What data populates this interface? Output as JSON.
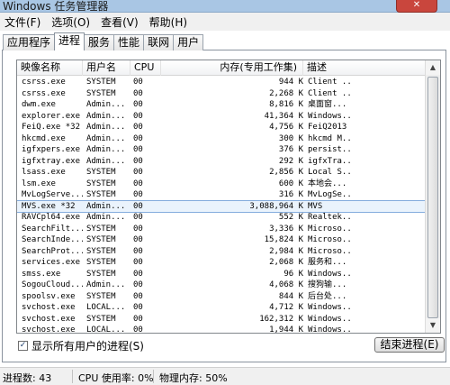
{
  "window": {
    "title": "Windows 任务管理器",
    "close_glyph": "✕"
  },
  "menu": [
    "文件(F)",
    "选项(O)",
    "查看(V)",
    "帮助(H)"
  ],
  "tabs": [
    "应用程序",
    "进程",
    "服务",
    "性能",
    "联网",
    "用户"
  ],
  "active_tab": "进程",
  "columns": {
    "name": "映像名称",
    "user": "用户名",
    "cpu": "CPU",
    "mem": "内存(专用工作集)",
    "desc": "描述"
  },
  "processes": [
    {
      "name": "csrss.exe",
      "user": "SYSTEM",
      "cpu": "00",
      "mem": "944 K",
      "desc": "Client ..."
    },
    {
      "name": "csrss.exe",
      "user": "SYSTEM",
      "cpu": "00",
      "mem": "2,268 K",
      "desc": "Client ..."
    },
    {
      "name": "dwm.exe",
      "user": "Admin...",
      "cpu": "00",
      "mem": "8,816 K",
      "desc": "桌面窗..."
    },
    {
      "name": "explorer.exe",
      "user": "Admin...",
      "cpu": "00",
      "mem": "41,364 K",
      "desc": "Windows..."
    },
    {
      "name": "FeiQ.exe *32",
      "user": "Admin...",
      "cpu": "00",
      "mem": "4,756 K",
      "desc": "FeiQ2013"
    },
    {
      "name": "hkcmd.exe",
      "user": "Admin...",
      "cpu": "00",
      "mem": "300 K",
      "desc": "hkcmd M..."
    },
    {
      "name": "igfxpers.exe",
      "user": "Admin...",
      "cpu": "00",
      "mem": "376 K",
      "desc": "persist..."
    },
    {
      "name": "igfxtray.exe",
      "user": "Admin...",
      "cpu": "00",
      "mem": "292 K",
      "desc": "igfxTra..."
    },
    {
      "name": "lsass.exe",
      "user": "SYSTEM",
      "cpu": "00",
      "mem": "2,856 K",
      "desc": "Local S..."
    },
    {
      "name": "lsm.exe",
      "user": "SYSTEM",
      "cpu": "00",
      "mem": "600 K",
      "desc": "本地会..."
    },
    {
      "name": "MvLogServe...",
      "user": "SYSTEM",
      "cpu": "00",
      "mem": "316 K",
      "desc": "MvLogSe..."
    },
    {
      "name": "MVS.exe *32",
      "user": "Admin...",
      "cpu": "00",
      "mem": "3,088,964 K",
      "desc": "MVS",
      "selected": true
    },
    {
      "name": "RAVCpl64.exe",
      "user": "Admin...",
      "cpu": "00",
      "mem": "552 K",
      "desc": "Realtek..."
    },
    {
      "name": "SearchFilt...",
      "user": "SYSTEM",
      "cpu": "00",
      "mem": "3,336 K",
      "desc": "Microso..."
    },
    {
      "name": "SearchInde...",
      "user": "SYSTEM",
      "cpu": "00",
      "mem": "15,824 K",
      "desc": "Microso..."
    },
    {
      "name": "SearchProt...",
      "user": "SYSTEM",
      "cpu": "00",
      "mem": "2,984 K",
      "desc": "Microso..."
    },
    {
      "name": "services.exe",
      "user": "SYSTEM",
      "cpu": "00",
      "mem": "2,068 K",
      "desc": "服务和..."
    },
    {
      "name": "smss.exe",
      "user": "SYSTEM",
      "cpu": "00",
      "mem": "96 K",
      "desc": "Windows..."
    },
    {
      "name": "SogouCloud...",
      "user": "Admin...",
      "cpu": "00",
      "mem": "4,068 K",
      "desc": "搜狗输..."
    },
    {
      "name": "spoolsv.exe",
      "user": "SYSTEM",
      "cpu": "00",
      "mem": "844 K",
      "desc": "后台处..."
    },
    {
      "name": "svchost.exe",
      "user": "LOCAL...",
      "cpu": "00",
      "mem": "4,712 K",
      "desc": "Windows..."
    },
    {
      "name": "svchost.exe",
      "user": "SYSTEM",
      "cpu": "00",
      "mem": "162,312 K",
      "desc": "Windows..."
    },
    {
      "name": "svchost.exe",
      "user": "LOCAL...",
      "cpu": "00",
      "mem": "1,944 K",
      "desc": "Windows..."
    }
  ],
  "show_all_users": {
    "label": "显示所有用户的进程(S)",
    "checked": true,
    "check_glyph": "✓"
  },
  "end_process_label": "结束进程(E)",
  "status": {
    "process_count": "进程数: 43",
    "cpu_usage": "CPU 使用率: 0%",
    "physical_memory": "物理内存: 50%"
  },
  "scroll_glyphs": {
    "up": "▲",
    "down": "▼"
  }
}
